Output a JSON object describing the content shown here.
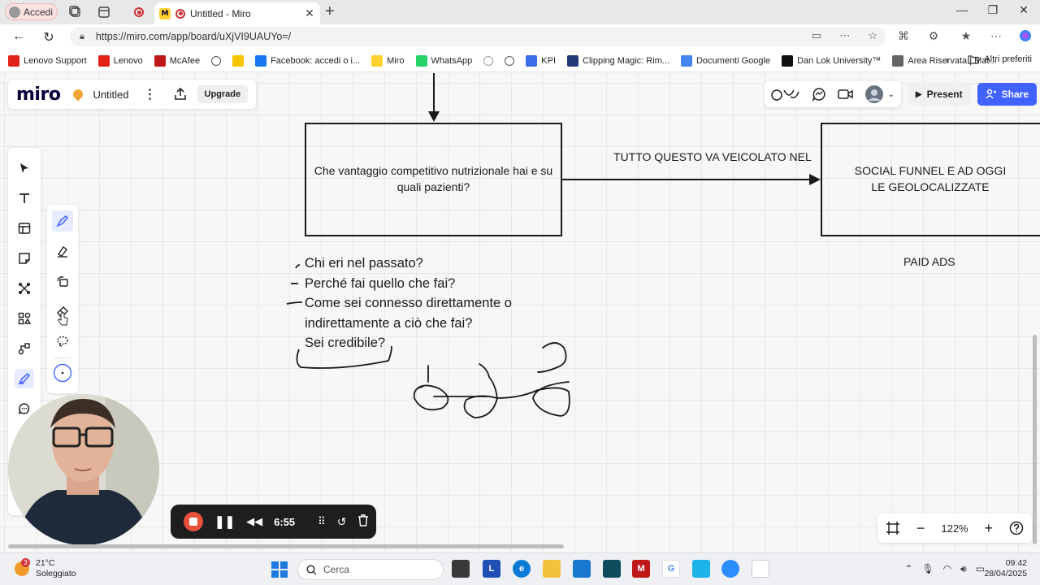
{
  "browser": {
    "profile_label": "Accedi",
    "tab_title": "Untitled - Miro",
    "url": "https://miro.com/app/board/uXjVI9UAUYo=/",
    "bookmarks": [
      {
        "label": "Lenovo Support",
        "icon": "lenovo-icon",
        "color": "#e2231a"
      },
      {
        "label": "Lenovo",
        "icon": "lenovo-icon",
        "color": "#e2231a"
      },
      {
        "label": "McAfee",
        "icon": "mcafee-icon",
        "color": "#c01818"
      },
      {
        "label": "",
        "icon": "globe-icon",
        "color": "#555555"
      },
      {
        "label": "",
        "icon": "norton-icon",
        "color": "#f5c400"
      },
      {
        "label": "Facebook: accedi o i...",
        "icon": "facebook-icon",
        "color": "#1877f2"
      },
      {
        "label": "Miro",
        "icon": "miro-icon",
        "color": "#ffd02f"
      },
      {
        "label": "WhatsApp",
        "icon": "whatsapp-icon",
        "color": "#25d366"
      },
      {
        "label": "",
        "icon": "dot-icon",
        "color": "#999999"
      },
      {
        "label": "",
        "icon": "globe-icon",
        "color": "#555555"
      },
      {
        "label": "KPI",
        "icon": "kpi-icon",
        "color": "#3b6ee6"
      },
      {
        "label": "Clipping Magic: Rim...",
        "icon": "clippingmagic-icon",
        "color": "#223a7a"
      },
      {
        "label": "Documenti Google",
        "icon": "google-docs-icon",
        "color": "#4285f4"
      },
      {
        "label": "Dan Lok University™",
        "icon": "danlok-icon",
        "color": "#111111"
      },
      {
        "label": "Area Riservata | Mat...",
        "icon": "mp-icon",
        "color": "#666666"
      }
    ],
    "bookmarks_more": "Altri preferiti"
  },
  "miro": {
    "logo": "miro",
    "board_name": "Untitled",
    "upgrade_label": "Upgrade",
    "present_label": "Present",
    "share_label": "Share",
    "zoom_level": "122%",
    "accent": "#4262ff"
  },
  "board": {
    "box1_text": "Che vantaggio competitivo nutrizionale hai e su quali pazienti?",
    "arrow_label": "TUTTO QUESTO VA VEICOLATO NEL",
    "box2_text": "SOCIAL FUNNEL E AD OGGI LE GEOLOCALIZZATE",
    "paid_ads": "PAID ADS",
    "questions": [
      "Chi eri nel passato?",
      "Perché fai quello che fai?",
      "Come sei connesso direttamente o",
      "indirettamente a ciò che fai?",
      "Sei credibile?"
    ]
  },
  "recorder": {
    "time": "6:55"
  },
  "taskbar": {
    "weather_badge": "3",
    "temperature": "21°C",
    "condition": "Soleggiato",
    "search_placeholder": "Cerca",
    "time": "09:42",
    "date": "28/04/2025"
  }
}
